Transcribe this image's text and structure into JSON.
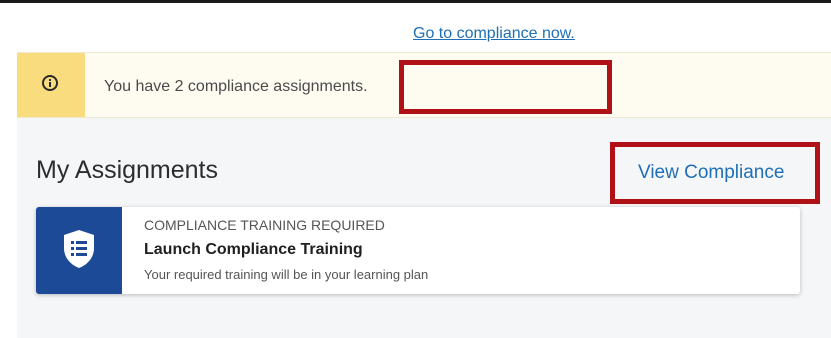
{
  "notice": {
    "icon": "info-icon",
    "message": "You have 2 compliance assignments.",
    "link_label": "Go to compliance now."
  },
  "assignments": {
    "title": "My Assignments",
    "view_link": "View Compliance",
    "card": {
      "icon": "shield-list-icon",
      "eyebrow": "COMPLIANCE TRAINING REQUIRED",
      "title": "Launch Compliance Training",
      "description": "Your required training will be in your learning plan"
    }
  },
  "colors": {
    "notice_icon_bg": "#f9dc7d",
    "link": "#1f6fb6",
    "card_icon_bg": "#1d4a96",
    "highlight": "#b01116"
  }
}
